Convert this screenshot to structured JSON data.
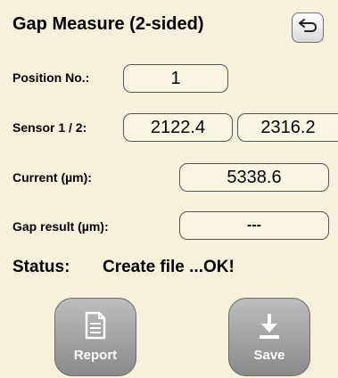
{
  "header": {
    "title": "Gap Measure (2-sided)",
    "back_icon": "back-arrow-icon"
  },
  "position": {
    "label": "Position No.:",
    "value": "1"
  },
  "sensor": {
    "label": "Sensor 1 / 2:",
    "value1": "2122.4",
    "value2": "2316.2"
  },
  "current": {
    "label": "Current (µm):",
    "value": "5338.6"
  },
  "gap": {
    "label": "Gap result (µm):",
    "value": "---"
  },
  "status": {
    "label": "Status:",
    "value": "Create file ...OK!"
  },
  "buttons": {
    "report_label": "Report",
    "report_icon": "document-icon",
    "save_label": "Save",
    "save_icon": "download-arrow-icon"
  }
}
